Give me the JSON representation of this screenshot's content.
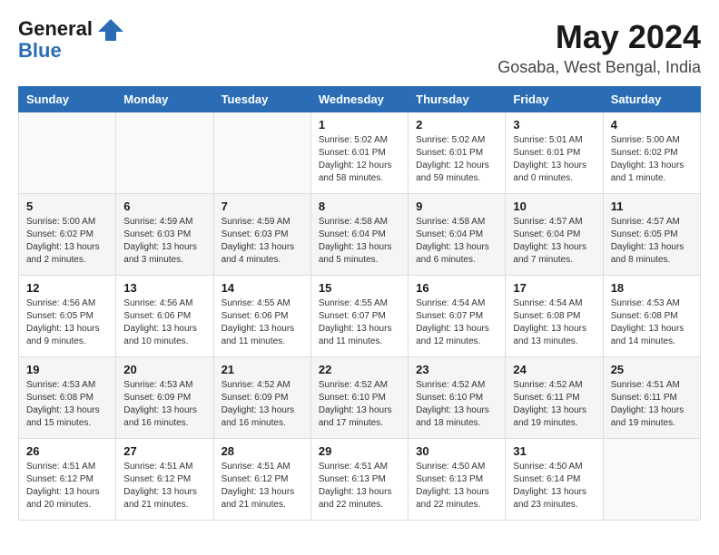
{
  "header": {
    "logo_line1": "General",
    "logo_line2": "Blue",
    "month": "May 2024",
    "location": "Gosaba, West Bengal, India"
  },
  "weekdays": [
    "Sunday",
    "Monday",
    "Tuesday",
    "Wednesday",
    "Thursday",
    "Friday",
    "Saturday"
  ],
  "weeks": [
    [
      {
        "day": "",
        "sunrise": "",
        "sunset": "",
        "daylight": ""
      },
      {
        "day": "",
        "sunrise": "",
        "sunset": "",
        "daylight": ""
      },
      {
        "day": "",
        "sunrise": "",
        "sunset": "",
        "daylight": ""
      },
      {
        "day": "1",
        "sunrise": "Sunrise: 5:02 AM",
        "sunset": "Sunset: 6:01 PM",
        "daylight": "Daylight: 12 hours and 58 minutes."
      },
      {
        "day": "2",
        "sunrise": "Sunrise: 5:02 AM",
        "sunset": "Sunset: 6:01 PM",
        "daylight": "Daylight: 12 hours and 59 minutes."
      },
      {
        "day": "3",
        "sunrise": "Sunrise: 5:01 AM",
        "sunset": "Sunset: 6:01 PM",
        "daylight": "Daylight: 13 hours and 0 minutes."
      },
      {
        "day": "4",
        "sunrise": "Sunrise: 5:00 AM",
        "sunset": "Sunset: 6:02 PM",
        "daylight": "Daylight: 13 hours and 1 minute."
      }
    ],
    [
      {
        "day": "5",
        "sunrise": "Sunrise: 5:00 AM",
        "sunset": "Sunset: 6:02 PM",
        "daylight": "Daylight: 13 hours and 2 minutes."
      },
      {
        "day": "6",
        "sunrise": "Sunrise: 4:59 AM",
        "sunset": "Sunset: 6:03 PM",
        "daylight": "Daylight: 13 hours and 3 minutes."
      },
      {
        "day": "7",
        "sunrise": "Sunrise: 4:59 AM",
        "sunset": "Sunset: 6:03 PM",
        "daylight": "Daylight: 13 hours and 4 minutes."
      },
      {
        "day": "8",
        "sunrise": "Sunrise: 4:58 AM",
        "sunset": "Sunset: 6:04 PM",
        "daylight": "Daylight: 13 hours and 5 minutes."
      },
      {
        "day": "9",
        "sunrise": "Sunrise: 4:58 AM",
        "sunset": "Sunset: 6:04 PM",
        "daylight": "Daylight: 13 hours and 6 minutes."
      },
      {
        "day": "10",
        "sunrise": "Sunrise: 4:57 AM",
        "sunset": "Sunset: 6:04 PM",
        "daylight": "Daylight: 13 hours and 7 minutes."
      },
      {
        "day": "11",
        "sunrise": "Sunrise: 4:57 AM",
        "sunset": "Sunset: 6:05 PM",
        "daylight": "Daylight: 13 hours and 8 minutes."
      }
    ],
    [
      {
        "day": "12",
        "sunrise": "Sunrise: 4:56 AM",
        "sunset": "Sunset: 6:05 PM",
        "daylight": "Daylight: 13 hours and 9 minutes."
      },
      {
        "day": "13",
        "sunrise": "Sunrise: 4:56 AM",
        "sunset": "Sunset: 6:06 PM",
        "daylight": "Daylight: 13 hours and 10 minutes."
      },
      {
        "day": "14",
        "sunrise": "Sunrise: 4:55 AM",
        "sunset": "Sunset: 6:06 PM",
        "daylight": "Daylight: 13 hours and 11 minutes."
      },
      {
        "day": "15",
        "sunrise": "Sunrise: 4:55 AM",
        "sunset": "Sunset: 6:07 PM",
        "daylight": "Daylight: 13 hours and 11 minutes."
      },
      {
        "day": "16",
        "sunrise": "Sunrise: 4:54 AM",
        "sunset": "Sunset: 6:07 PM",
        "daylight": "Daylight: 13 hours and 12 minutes."
      },
      {
        "day": "17",
        "sunrise": "Sunrise: 4:54 AM",
        "sunset": "Sunset: 6:08 PM",
        "daylight": "Daylight: 13 hours and 13 minutes."
      },
      {
        "day": "18",
        "sunrise": "Sunrise: 4:53 AM",
        "sunset": "Sunset: 6:08 PM",
        "daylight": "Daylight: 13 hours and 14 minutes."
      }
    ],
    [
      {
        "day": "19",
        "sunrise": "Sunrise: 4:53 AM",
        "sunset": "Sunset: 6:08 PM",
        "daylight": "Daylight: 13 hours and 15 minutes."
      },
      {
        "day": "20",
        "sunrise": "Sunrise: 4:53 AM",
        "sunset": "Sunset: 6:09 PM",
        "daylight": "Daylight: 13 hours and 16 minutes."
      },
      {
        "day": "21",
        "sunrise": "Sunrise: 4:52 AM",
        "sunset": "Sunset: 6:09 PM",
        "daylight": "Daylight: 13 hours and 16 minutes."
      },
      {
        "day": "22",
        "sunrise": "Sunrise: 4:52 AM",
        "sunset": "Sunset: 6:10 PM",
        "daylight": "Daylight: 13 hours and 17 minutes."
      },
      {
        "day": "23",
        "sunrise": "Sunrise: 4:52 AM",
        "sunset": "Sunset: 6:10 PM",
        "daylight": "Daylight: 13 hours and 18 minutes."
      },
      {
        "day": "24",
        "sunrise": "Sunrise: 4:52 AM",
        "sunset": "Sunset: 6:11 PM",
        "daylight": "Daylight: 13 hours and 19 minutes."
      },
      {
        "day": "25",
        "sunrise": "Sunrise: 4:51 AM",
        "sunset": "Sunset: 6:11 PM",
        "daylight": "Daylight: 13 hours and 19 minutes."
      }
    ],
    [
      {
        "day": "26",
        "sunrise": "Sunrise: 4:51 AM",
        "sunset": "Sunset: 6:12 PM",
        "daylight": "Daylight: 13 hours and 20 minutes."
      },
      {
        "day": "27",
        "sunrise": "Sunrise: 4:51 AM",
        "sunset": "Sunset: 6:12 PM",
        "daylight": "Daylight: 13 hours and 21 minutes."
      },
      {
        "day": "28",
        "sunrise": "Sunrise: 4:51 AM",
        "sunset": "Sunset: 6:12 PM",
        "daylight": "Daylight: 13 hours and 21 minutes."
      },
      {
        "day": "29",
        "sunrise": "Sunrise: 4:51 AM",
        "sunset": "Sunset: 6:13 PM",
        "daylight": "Daylight: 13 hours and 22 minutes."
      },
      {
        "day": "30",
        "sunrise": "Sunrise: 4:50 AM",
        "sunset": "Sunset: 6:13 PM",
        "daylight": "Daylight: 13 hours and 22 minutes."
      },
      {
        "day": "31",
        "sunrise": "Sunrise: 4:50 AM",
        "sunset": "Sunset: 6:14 PM",
        "daylight": "Daylight: 13 hours and 23 minutes."
      },
      {
        "day": "",
        "sunrise": "",
        "sunset": "",
        "daylight": ""
      }
    ]
  ]
}
